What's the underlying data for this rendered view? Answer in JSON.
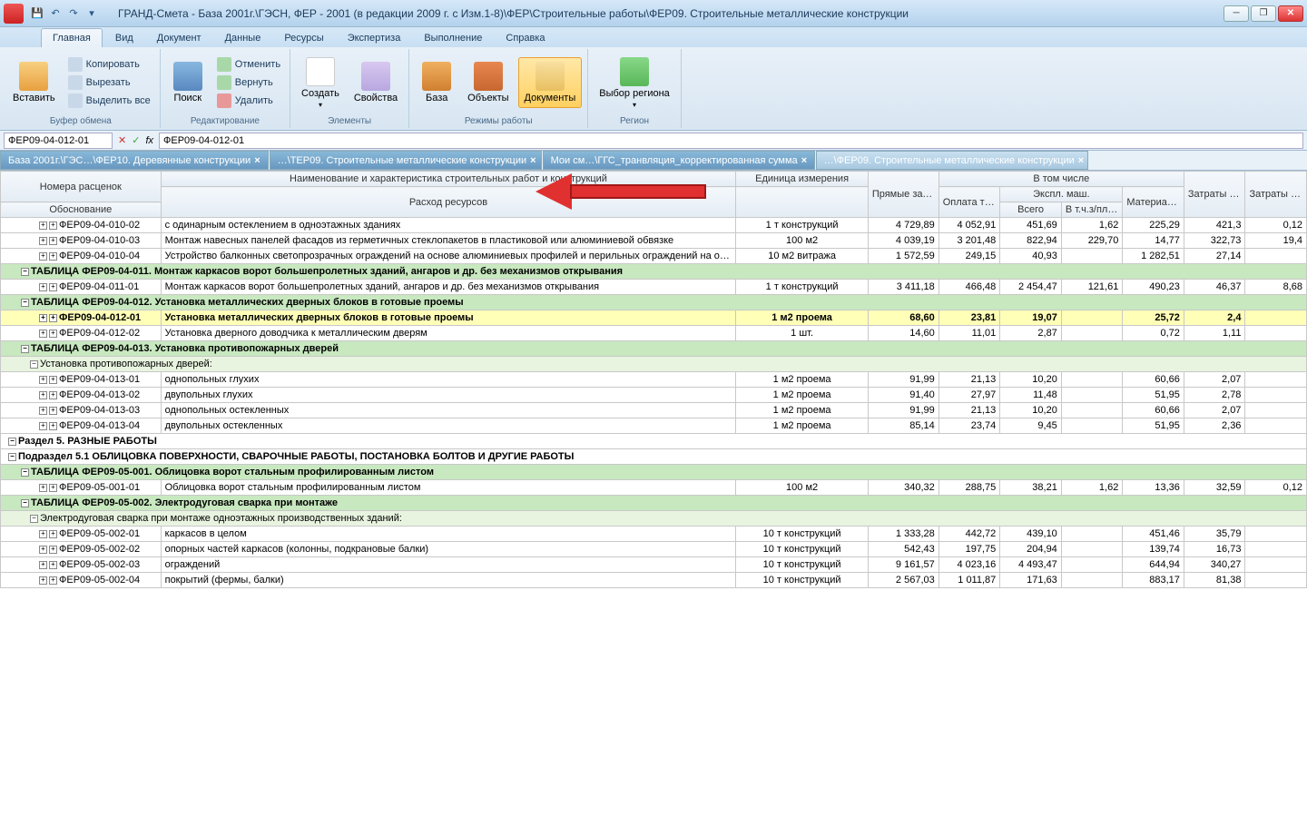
{
  "title": "ГРАНД-Смета - База 2001г.\\ГЭСН, ФЕР - 2001 (в редакции 2009 г. с Изм.1-8)\\ФЕР\\Строительные работы\\ФЕР09. Строительные металлические конструкции",
  "ribbon_tabs": [
    "Главная",
    "Вид",
    "Документ",
    "Данные",
    "Ресурсы",
    "Экспертиза",
    "Выполнение",
    "Справка"
  ],
  "groups": {
    "clipboard": {
      "label": "Буфер обмена",
      "paste": "Вставить",
      "copy": "Копировать",
      "cut": "Вырезать",
      "selall": "Выделить все"
    },
    "edit": {
      "label": "Редактирование",
      "search": "Поиск",
      "undo": "Отменить",
      "redo": "Вернуть",
      "delete": "Удалить"
    },
    "elements": {
      "label": "Элементы",
      "create": "Создать",
      "props": "Свойства"
    },
    "modes": {
      "label": "Режимы работы",
      "base": "База",
      "objects": "Объекты",
      "docs": "Документы"
    },
    "region": {
      "label": "Регион",
      "choose": "Выбор региона"
    }
  },
  "formula": {
    "name": "ФЕР09-04-012-01",
    "fx": "fx",
    "value": "ФЕР09-04-012-01"
  },
  "doc_tabs": [
    "База 2001г.\\ГЭС…\\ФЕР10. Деревянные конструкции",
    "…\\ТЕР09. Строительные металлические конструкции",
    "Мои см…\\ГГС_транвляция_корректированная сумма",
    "…\\ФЕР09. Строительные металлические конструкции"
  ],
  "headers": {
    "num": "Номера расценок",
    "osnov": "Обоснование",
    "name": "Наименование и характеристика строительных работ и конструкций",
    "rashod": "Расход ресурсов",
    "ed": "Единица измерения",
    "pz": "Прямые затраты",
    "vtom": "В том числе",
    "opl": "Оплата труда рабочих",
    "ekspl": "Экспл. маш.",
    "vsego": "Всего",
    "vtch": "В т.ч.з/пл маш-стов",
    "mat": "Материалы",
    "ztr": "Затраты труда рабочих",
    "ztm": "Затраты труда маш-стов"
  },
  "rows": [
    {
      "t": "d",
      "code": "ФЕР09-04-010-02",
      "name": "с одинарным остеклением в одноэтажных зданиях",
      "ed": "1 т конструкций",
      "pz": "4 729,89",
      "opl": "4 052,91",
      "vs": "451,69",
      "vt": "1,62",
      "mat": "225,29",
      "ztr": "421,3",
      "ztm": "0,12"
    },
    {
      "t": "d",
      "code": "ФЕР09-04-010-03",
      "name": "Монтаж навесных панелей фасадов из герметичных стеклопакетов в пластиковой или алюминиевой обвязке",
      "ed": "100 м2",
      "pz": "4 039,19",
      "opl": "3 201,48",
      "vs": "822,94",
      "vt": "229,70",
      "mat": "14,77",
      "ztr": "322,73",
      "ztm": "19,4"
    },
    {
      "t": "d",
      "code": "ФЕР09-04-010-04",
      "name": "Устройство балконных светопрозрачных ограждений на основе алюминиевых профилей и перильных ограждений на основе стального каркаса",
      "ed": "10 м2 витража",
      "pz": "1 572,59",
      "opl": "249,15",
      "vs": "40,93",
      "vt": "",
      "mat": "1 282,51",
      "ztr": "27,14",
      "ztm": ""
    },
    {
      "t": "h",
      "name": "ТАБЛИЦА ФЕР09-04-011. Монтаж каркасов ворот большепролетных зданий, ангаров и др. без механизмов открывания"
    },
    {
      "t": "d",
      "code": "ФЕР09-04-011-01",
      "name": "Монтаж каркасов ворот большепролетных зданий, ангаров и др. без механизмов открывания",
      "ed": "1 т конструкций",
      "pz": "3 411,18",
      "opl": "466,48",
      "vs": "2 454,47",
      "vt": "121,61",
      "mat": "490,23",
      "ztr": "46,37",
      "ztm": "8,68"
    },
    {
      "t": "h",
      "name": "ТАБЛИЦА ФЕР09-04-012. Установка металлических дверных блоков в готовые проемы"
    },
    {
      "t": "sel",
      "code": "ФЕР09-04-012-01",
      "name": "Установка металлических дверных блоков в готовые проемы",
      "ed": "1 м2 проема",
      "pz": "68,60",
      "opl": "23,81",
      "vs": "19,07",
      "vt": "",
      "mat": "25,72",
      "ztr": "2,4",
      "ztm": ""
    },
    {
      "t": "d",
      "code": "ФЕР09-04-012-02",
      "name": "Установка дверного доводчика к металлическим дверям",
      "ed": "1 шт.",
      "pz": "14,60",
      "opl": "11,01",
      "vs": "2,87",
      "vt": "",
      "mat": "0,72",
      "ztr": "1,11",
      "ztm": ""
    },
    {
      "t": "h",
      "name": "ТАБЛИЦА ФЕР09-04-013. Установка противопожарных дверей"
    },
    {
      "t": "s",
      "name": "Установка противопожарных дверей:"
    },
    {
      "t": "d",
      "code": "ФЕР09-04-013-01",
      "name": "однопольных глухих",
      "ed": "1 м2 проема",
      "pz": "91,99",
      "opl": "21,13",
      "vs": "10,20",
      "vt": "",
      "mat": "60,66",
      "ztr": "2,07",
      "ztm": ""
    },
    {
      "t": "d",
      "code": "ФЕР09-04-013-02",
      "name": "двупольных глухих",
      "ed": "1 м2 проема",
      "pz": "91,40",
      "opl": "27,97",
      "vs": "11,48",
      "vt": "",
      "mat": "51,95",
      "ztr": "2,78",
      "ztm": ""
    },
    {
      "t": "d",
      "code": "ФЕР09-04-013-03",
      "name": "однопольных остекленных",
      "ed": "1 м2 проема",
      "pz": "91,99",
      "opl": "21,13",
      "vs": "10,20",
      "vt": "",
      "mat": "60,66",
      "ztr": "2,07",
      "ztm": ""
    },
    {
      "t": "d",
      "code": "ФЕР09-04-013-04",
      "name": "двупольных остекленных",
      "ed": "1 м2 проема",
      "pz": "85,14",
      "opl": "23,74",
      "vs": "9,45",
      "vt": "",
      "mat": "51,95",
      "ztr": "2,36",
      "ztm": ""
    },
    {
      "t": "sec",
      "name": "Раздел 5. РАЗНЫЕ РАБОТЫ"
    },
    {
      "t": "sec",
      "name": "Подраздел 5.1 ОБЛИЦОВКА ПОВЕРХНОСТИ, СВАРОЧНЫЕ РАБОТЫ, ПОСТАНОВКА БОЛТОВ И ДРУГИЕ РАБОТЫ"
    },
    {
      "t": "h",
      "name": "ТАБЛИЦА ФЕР09-05-001. Облицовка ворот стальным профилированным листом"
    },
    {
      "t": "d",
      "code": "ФЕР09-05-001-01",
      "name": "Облицовка ворот стальным профилированным листом",
      "ed": "100 м2",
      "pz": "340,32",
      "opl": "288,75",
      "vs": "38,21",
      "vt": "1,62",
      "mat": "13,36",
      "ztr": "32,59",
      "ztm": "0,12"
    },
    {
      "t": "h",
      "name": "ТАБЛИЦА ФЕР09-05-002. Электродуговая сварка при монтаже"
    },
    {
      "t": "s",
      "name": "Электродуговая сварка при монтаже одноэтажных производственных зданий:"
    },
    {
      "t": "d",
      "code": "ФЕР09-05-002-01",
      "name": "каркасов в целом",
      "ed": "10 т конструкций",
      "pz": "1 333,28",
      "opl": "442,72",
      "vs": "439,10",
      "vt": "",
      "mat": "451,46",
      "ztr": "35,79",
      "ztm": ""
    },
    {
      "t": "d",
      "code": "ФЕР09-05-002-02",
      "name": "опорных частей каркасов (колонны, подкрановые балки)",
      "ed": "10 т конструкций",
      "pz": "542,43",
      "opl": "197,75",
      "vs": "204,94",
      "vt": "",
      "mat": "139,74",
      "ztr": "16,73",
      "ztm": ""
    },
    {
      "t": "d",
      "code": "ФЕР09-05-002-03",
      "name": "ограждений",
      "ed": "10 т конструкций",
      "pz": "9 161,57",
      "opl": "4 023,16",
      "vs": "4 493,47",
      "vt": "",
      "mat": "644,94",
      "ztr": "340,27",
      "ztm": ""
    },
    {
      "t": "d",
      "code": "ФЕР09-05-002-04",
      "name": "покрытий (фермы, балки)",
      "ed": "10 т конструкций",
      "pz": "2 567,03",
      "opl": "1 011,87",
      "vs": "171,63",
      "vt": "",
      "mat": "883,17",
      "ztr": "81,38",
      "ztm": ""
    }
  ]
}
